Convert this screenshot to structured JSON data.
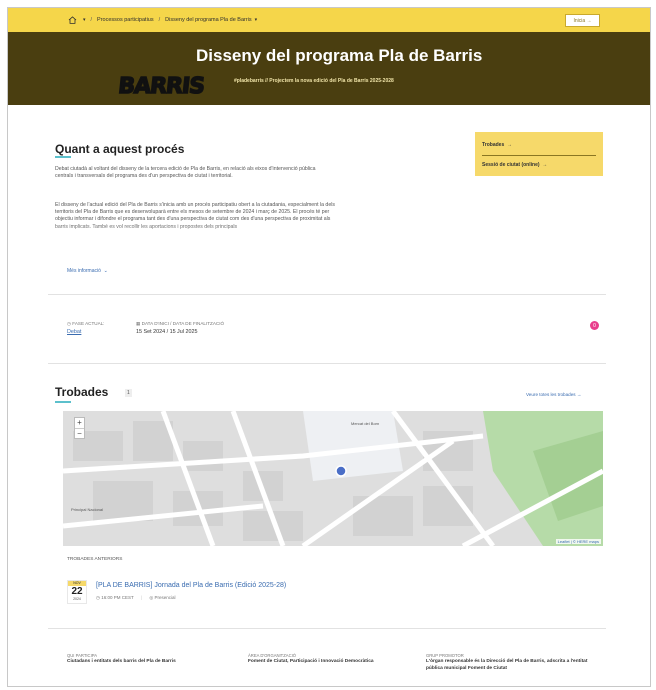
{
  "nav": {
    "breadcrumb_sep": "/",
    "breadcrumb_1": "Processos participatius",
    "breadcrumb_2": "Disseny del programa Pla de Barris",
    "login_label": "Inicia"
  },
  "banner": {
    "title": "Disseny del programa Pla de Barris",
    "subtitle": "#pladebarris // Projectem la nova edició del Pla de Barris 2025-2028",
    "logo_text": "BARRIS"
  },
  "about": {
    "title": "Quant a aquest procés",
    "p1": "Debat ciutadà al voltant del disseny de la tercera edició de Pla de Barris, en relació als eixos d'intervenció pública centrals i transversals del programa des d'un perspectiva de ciutat i territorial.",
    "p2": "El disseny de l'actual edició del Pla de Barris s'inicia amb un procés participatiu obert a la ciutadania, especialment la dels territoris del Pla de Barris que es desenvoluparà entre els mesos de setembre de 2024 i març de 2025. El procés té per objectiu informar i difondre el programa tant des d'una perspectiva de ciutat com des d'una perspectiva de proximitat als barris implicats. També es vol recollir les aportacions i propostes dels principals",
    "more_label": "Més informació"
  },
  "sidebox": {
    "item1": "Trobades",
    "item2": "Sessió de ciutat (online)"
  },
  "phase": {
    "label": "FASE ACTUAL:",
    "value": "Debat",
    "dates_label": "DATA D'INICI / DATA DE FINALITZACIÓ",
    "dates_value": "15 Set 2024 / 15 Jul 2025",
    "badge": "0"
  },
  "meetings": {
    "title": "Trobades",
    "count": "1",
    "see_all": "Veure totes les trobades",
    "map_attrib": "Leaflet | © HERE maps",
    "map_label_1": "Mercat del Born",
    "map_label_2": "Principal Nacional",
    "previous_label": "TROBADES ANTERIORS",
    "event": {
      "month": "NOV",
      "day": "22",
      "year": "2024",
      "title": "[PLA DE BARRIS] Jornada del Pla de Barris (Edició 2025-28)",
      "time": "16:00 PM CEST",
      "type": "Presencial"
    }
  },
  "footer": {
    "who_label": "QUI PARTICIPA",
    "who_value": "Ciutadans i entitats dels barris del Pla de Barris",
    "area_label": "ÀREA D'ORGANITZACIÓ",
    "area_value": "Foment de Ciutat, Participació i Innovació Democràtica",
    "group_label": "GRUP PROMOTOR",
    "group_value": "L'òrgan responsable és la Direcció del Pla de Barris, adscrita a l'entitat pública municipal Foment de Ciutat"
  }
}
